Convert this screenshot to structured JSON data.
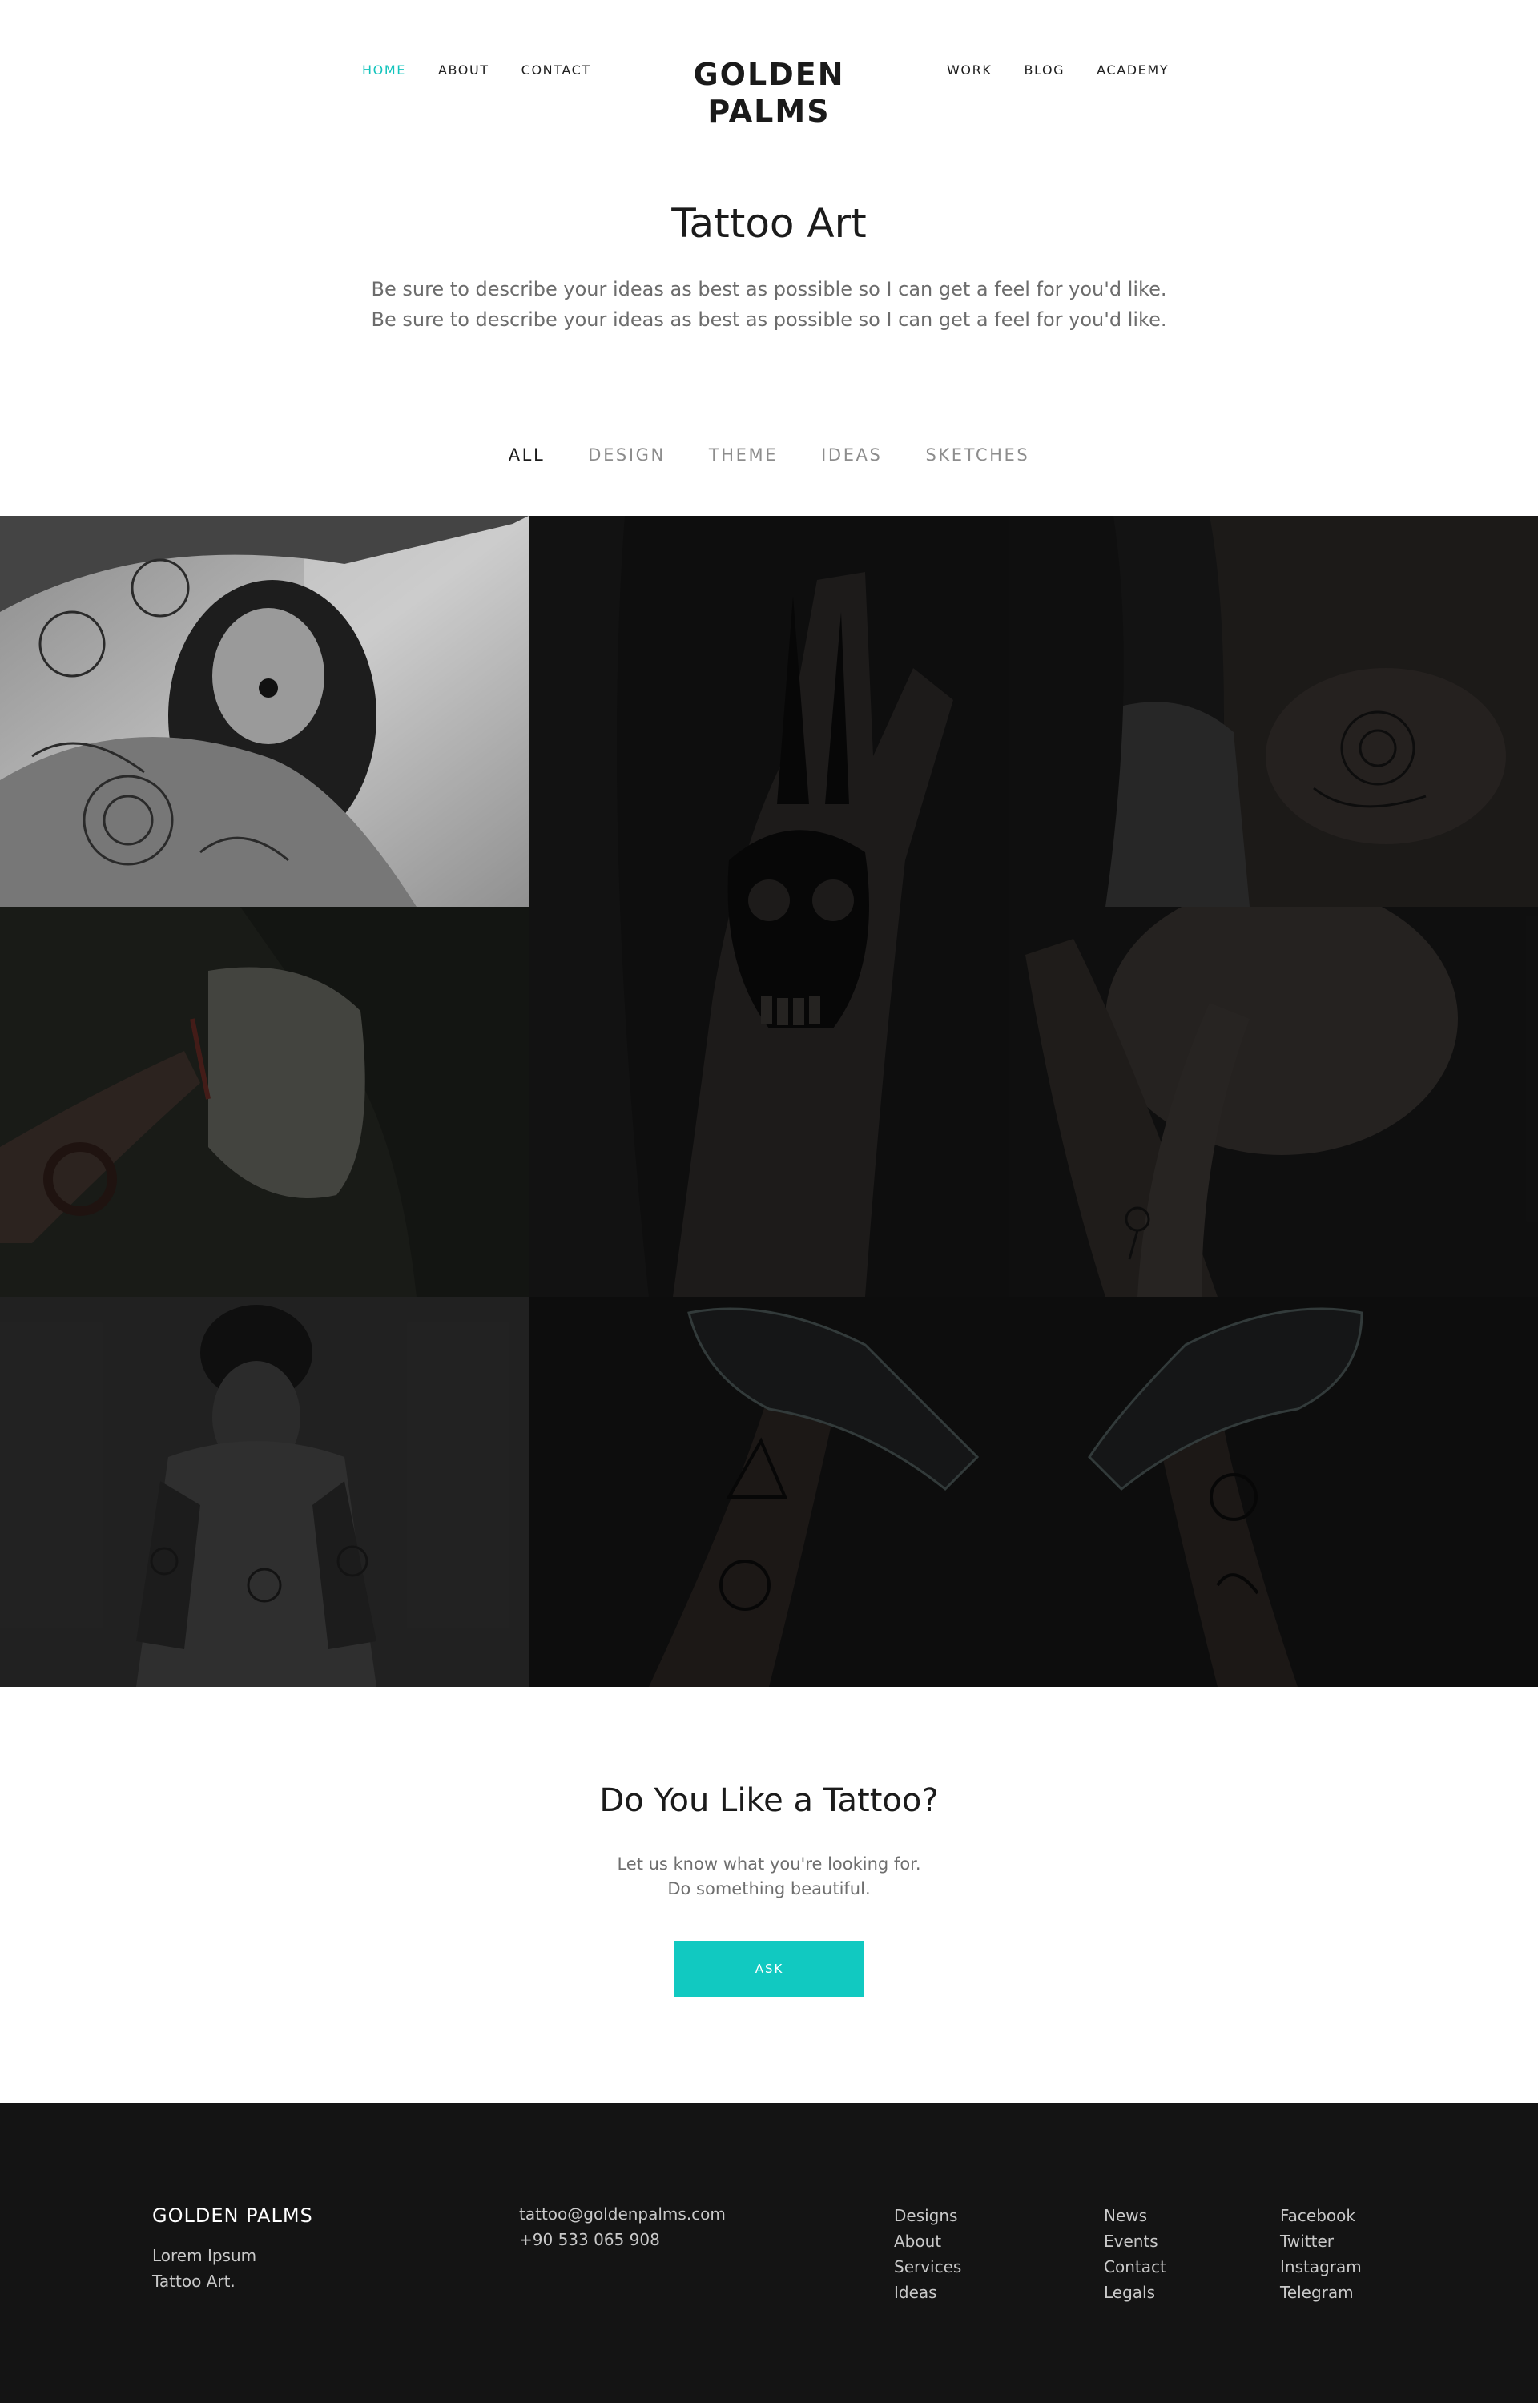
{
  "nav": {
    "left": [
      {
        "label": "HOME",
        "active": true
      },
      {
        "label": "ABOUT",
        "active": false
      },
      {
        "label": "CONTACT",
        "active": false
      }
    ],
    "right": [
      {
        "label": "WORK"
      },
      {
        "label": "BLOG"
      },
      {
        "label": "ACADEMY"
      }
    ]
  },
  "logo": {
    "line1": "GOLDEN",
    "line2": "PALMS"
  },
  "intro": {
    "title": "Tattoo Art",
    "line1": "Be sure to describe your ideas as best as possible so I can get a feel for you'd like.",
    "line2": "Be sure to describe your ideas as best as possible so I can get a feel for you'd like."
  },
  "filters": [
    {
      "label": "ALL",
      "active": true
    },
    {
      "label": "DESIGN",
      "active": false
    },
    {
      "label": "THEME",
      "active": false
    },
    {
      "label": "IDEAS",
      "active": false
    },
    {
      "label": "SKETCHES",
      "active": false
    }
  ],
  "cta": {
    "title": "Do You Like a Tattoo?",
    "line1": "Let us know what you're looking for.",
    "line2": "Do something beautiful.",
    "button": "ASK"
  },
  "footer": {
    "brand": "GOLDEN PALMS",
    "tagline1": "Lorem Ipsum",
    "tagline2": "Tattoo Art.",
    "email": "tattoo@goldenpalms.com",
    "phone": "+90 533 065 908",
    "col1": [
      "Designs",
      "About",
      "Services",
      "Ideas"
    ],
    "col2": [
      "News",
      "Events",
      "Contact",
      "Legals"
    ],
    "col3": [
      "Facebook",
      "Twitter",
      "Instagram",
      "Telegram"
    ]
  },
  "colors": {
    "accent": "#11c9c1",
    "footer_bg": "#141414",
    "gallery_bg": "#151515"
  }
}
